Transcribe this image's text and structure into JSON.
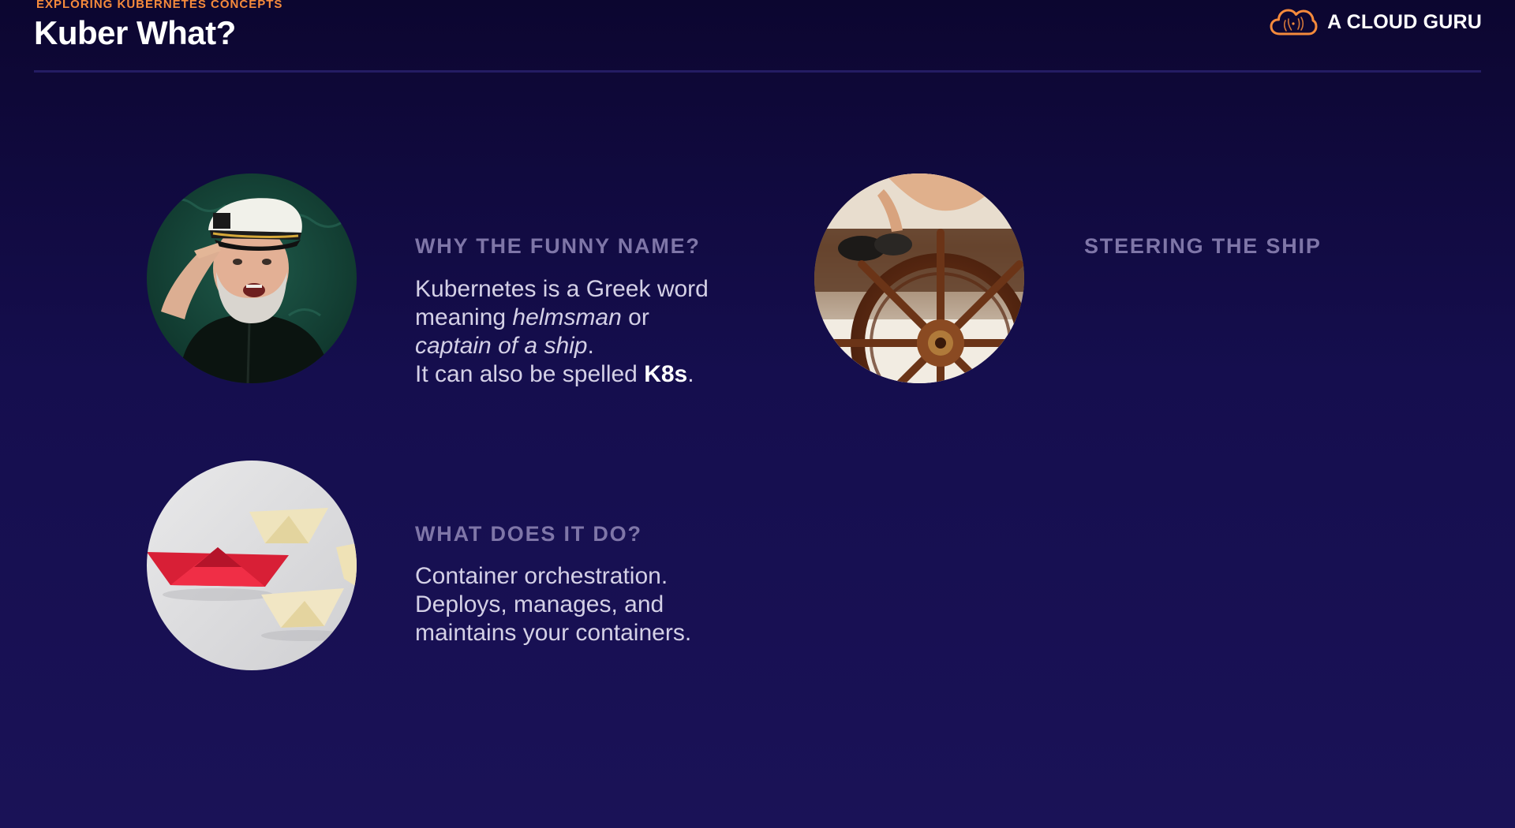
{
  "header": {
    "eyebrow": "EXPLORING KUBERNETES CONCEPTS",
    "title": "Kuber What?",
    "brand": "A CLOUD GURU",
    "brand_icon": "cloud-logo-icon"
  },
  "colors": {
    "background_top": "#0c0630",
    "background_bottom": "#1a1257",
    "accent_orange": "#f58a3c",
    "heading_muted": "#7f76a8",
    "body_text": "#d4d0e6"
  },
  "sections": {
    "funny_name": {
      "image": "sea-captain-photo",
      "heading": "WHY THE FUNNY NAME?",
      "line1": "Kubernetes is a Greek word",
      "line2_prefix": "meaning ",
      "line2_em": "helmsman",
      "line2_suffix": " or",
      "line3_em": "captain of a ship",
      "line3_suffix": ".",
      "line4_prefix": "It can also be spelled ",
      "line4_strong": "K8s",
      "line4_suffix": "."
    },
    "steering": {
      "image": "ship-wheel-photo",
      "heading": "STEERING THE SHIP"
    },
    "what_it_does": {
      "image": "paper-boats-photo",
      "heading": "WHAT DOES IT DO?",
      "line1": "Container orchestration.",
      "line2": "Deploys, manages, and",
      "line3": "maintains your containers."
    }
  }
}
